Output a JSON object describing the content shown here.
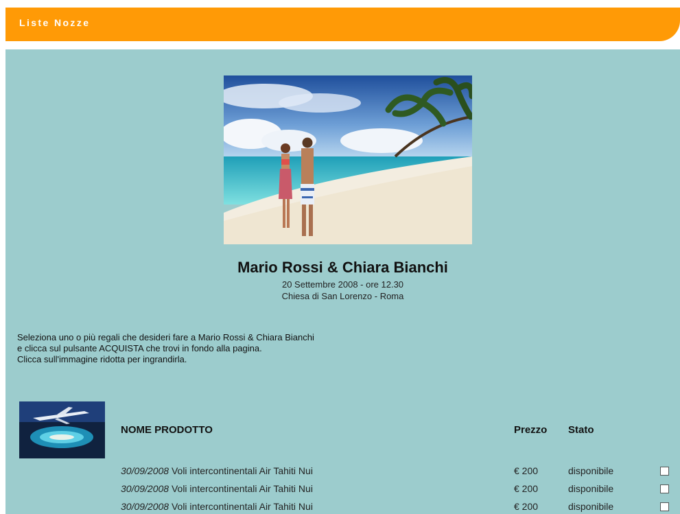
{
  "header": {
    "title": "Liste Nozze"
  },
  "couple": {
    "names": "Mario Rossi & Chiara Bianchi",
    "date_line": "20 Settembre 2008 - ore 12.30",
    "place_line": "Chiesa di San Lorenzo - Roma"
  },
  "intro": {
    "lines": [
      "Seleziona uno o più regali che desideri fare a Mario Rossi & Chiara Bianchi",
      "e clicca sul pulsante ACQUISTA che trovi in fondo alla pagina.",
      "Clicca sull'immagine ridotta per ingrandirla."
    ]
  },
  "table": {
    "columns": {
      "product": "NOME PRODOTTO",
      "price": "Prezzo",
      "status": "Stato"
    },
    "rows": [
      {
        "date": "30/09/2008",
        "name": "Voli intercontinentali Air Tahiti Nui",
        "price": "€ 200",
        "status": "disponibile"
      },
      {
        "date": "30/09/2008",
        "name": "Voli intercontinentali Air Tahiti Nui",
        "price": "€ 200",
        "status": "disponibile"
      },
      {
        "date": "30/09/2008",
        "name": "Voli intercontinentali Air Tahiti Nui",
        "price": "€ 200",
        "status": "disponibile"
      }
    ]
  },
  "colors": {
    "header_orange": "#ff9a06",
    "panel_teal": "#9ccccd"
  }
}
